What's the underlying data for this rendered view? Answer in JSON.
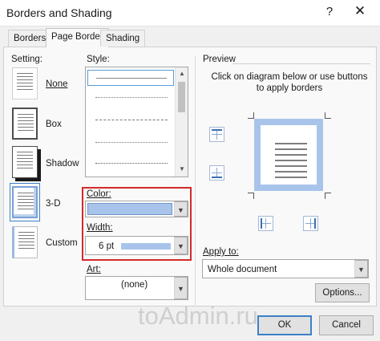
{
  "window": {
    "title": "Borders and Shading",
    "help_label": "?",
    "close_label": "✕"
  },
  "tabs": [
    {
      "label": "Borders",
      "active": false
    },
    {
      "label": "Page Border",
      "active": true
    },
    {
      "label": "Shading",
      "active": false
    }
  ],
  "setting": {
    "label": "Setting:",
    "options": [
      {
        "label": "None",
        "icon": "none-setting-icon"
      },
      {
        "label": "Box",
        "icon": "box-setting-icon"
      },
      {
        "label": "Shadow",
        "icon": "shadow-setting-icon"
      },
      {
        "label": "3-D",
        "icon": "3d-setting-icon"
      },
      {
        "label": "Custom",
        "icon": "custom-setting-icon"
      }
    ],
    "selected": "3-D"
  },
  "style": {
    "label": "Style:",
    "items": [
      "solid",
      "dotted",
      "dashed",
      "dash-dot",
      "dense-dotted"
    ]
  },
  "color": {
    "label": "Color:",
    "value": "#a9c4ea"
  },
  "width": {
    "label": "Width:",
    "value": "6 pt"
  },
  "art": {
    "label": "Art:",
    "value": "(none)"
  },
  "preview": {
    "label": "Preview",
    "instructions": "Click on diagram below or use buttons to apply borders",
    "border_color": "#a9c4ea"
  },
  "apply_to": {
    "label": "Apply to:",
    "value": "Whole document"
  },
  "buttons": {
    "options": "Options...",
    "ok": "OK",
    "cancel": "Cancel"
  },
  "watermark": "toAdmin.ru",
  "colors": {
    "highlight_red": "#d42a2a",
    "focus_blue": "#3d80c8"
  }
}
